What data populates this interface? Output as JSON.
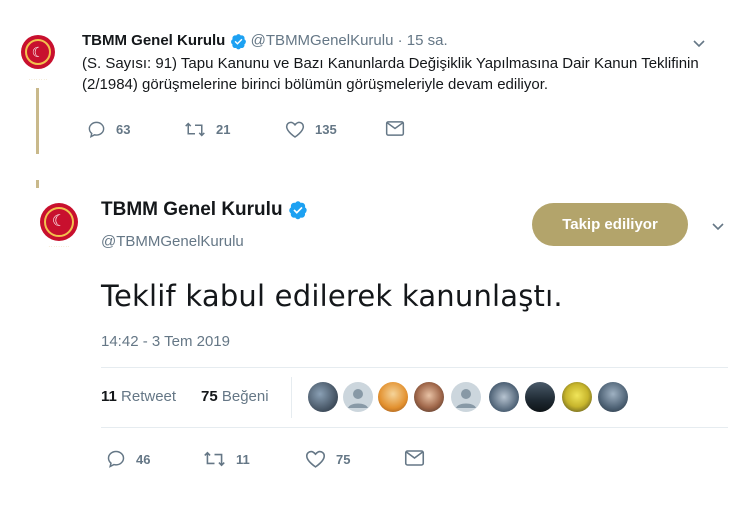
{
  "tweet1": {
    "name": "TBMM Genel Kurulu",
    "handle": "@TBMMGenelKurulu",
    "time": "· 15 sa.",
    "text": "(S. Sayısı: 91) Tapu Kanunu ve Bazı Kanunlarda Değişiklik Yapılmasına Dair Kanun Teklifinin (2/1984) görüşmelerine birinci bölümün görüşmeleriyle devam ediliyor.",
    "actions": {
      "replies": "63",
      "retweets": "21",
      "likes": "135"
    }
  },
  "tweet2": {
    "name": "TBMM Genel Kurulu",
    "handle": "@TBMMGenelKurulu",
    "follow_label": "Takip ediliyor",
    "text": "Teklif kabul edilerek kanunlaştı.",
    "timestamp": "14:42 - 3 Tem 2019",
    "stats": {
      "retweet_count": "11",
      "retweet_label": "Retweet",
      "like_count": "75",
      "like_label": "Beğeni"
    },
    "actions": {
      "replies": "46",
      "retweets": "11",
      "likes": "75"
    }
  },
  "colors": {
    "follow_button": "#b3a46b",
    "verified": "#1da1f2",
    "secondary_text": "#657786",
    "seal_red": "#c8102e",
    "seal_gold": "#f2c14e"
  },
  "icons": [
    "reply-icon",
    "retweet-icon",
    "like-icon",
    "message-icon",
    "chevron-down-icon",
    "verified-badge-icon"
  ]
}
